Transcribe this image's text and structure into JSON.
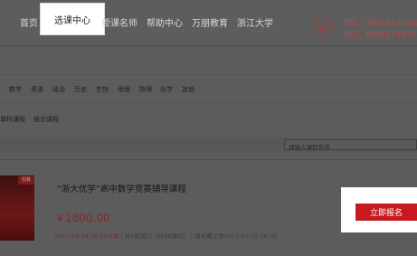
{
  "nav": {
    "items": [
      "首页",
      "选课中心",
      "授课名师",
      "帮助中心",
      "万朋教育",
      "浙江大学"
    ],
    "active": "选课中心"
  },
  "contact": {
    "tel": "TEL：400-617-1997",
    "qq": "QQ：4006171997",
    "icon": "phone-icon"
  },
  "filters": {
    "subjects": [
      "数学",
      "英语",
      "政治",
      "历史",
      "生物",
      "地理",
      "物理",
      "化学",
      "其他"
    ],
    "course_types": [
      "单科课程",
      "组合课程"
    ]
  },
  "search": {
    "placeholder": "请输入课程名称"
  },
  "course": {
    "tag": "招募",
    "title": "“浙大优学”高中数学竞赛辅导课程",
    "price": "￥1800.00",
    "start": "2017-04-29 08:30开课",
    "schedule": "共6周周六（共68课时）",
    "deadline": "报名截止至2017-07-15 16:30",
    "enroll_label": "立即报名"
  },
  "colors": {
    "accent": "#c81a1e",
    "overlay": "#5c5c5c"
  }
}
